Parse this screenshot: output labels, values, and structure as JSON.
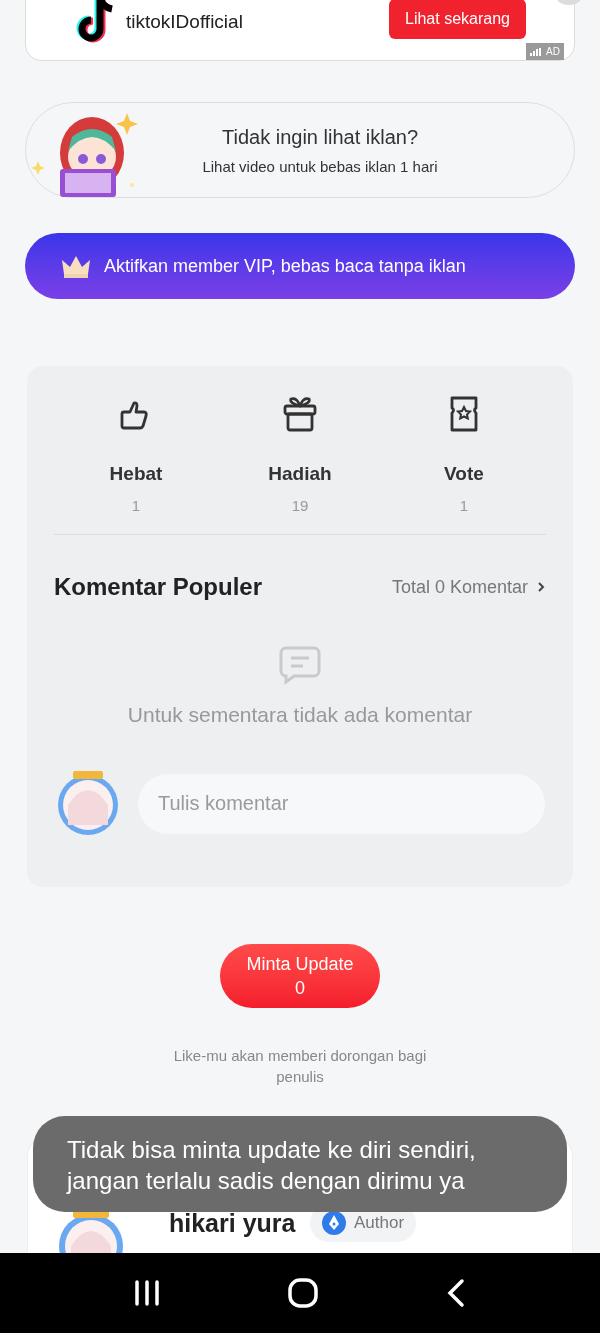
{
  "ad": {
    "advertiser": "tiktokIDofficial",
    "button": "Lihat sekarang",
    "tag": "AD"
  },
  "ad_free": {
    "title": "Tidak ingin lihat iklan?",
    "subtitle": "Lihat video untuk bebas iklan 1 hari"
  },
  "vip_button": {
    "label": "Aktifkan member VIP, bebas baca tanpa iklan"
  },
  "reactions": [
    {
      "kind": "like",
      "label": "Hebat",
      "count": "1"
    },
    {
      "kind": "gift",
      "label": "Hadiah",
      "count": "19"
    },
    {
      "kind": "vote",
      "label": "Vote",
      "count": "1"
    }
  ],
  "comments": {
    "title": "Komentar Populer",
    "total_link": "Total 0 Komentar",
    "empty_text": "Untuk sementara tidak ada komentar",
    "input": {
      "placeholder": "Tulis komentar"
    }
  },
  "request_update": {
    "label": "Minta Update",
    "count": "0"
  },
  "caption": "Like-mu akan memberi dorongan bagi penulis",
  "author": {
    "name": "hikari yura",
    "badge": "Author"
  },
  "toast": "Tidak bisa minta update ke diri sendiri, jangan terlalu sadis dengan dirimu ya"
}
